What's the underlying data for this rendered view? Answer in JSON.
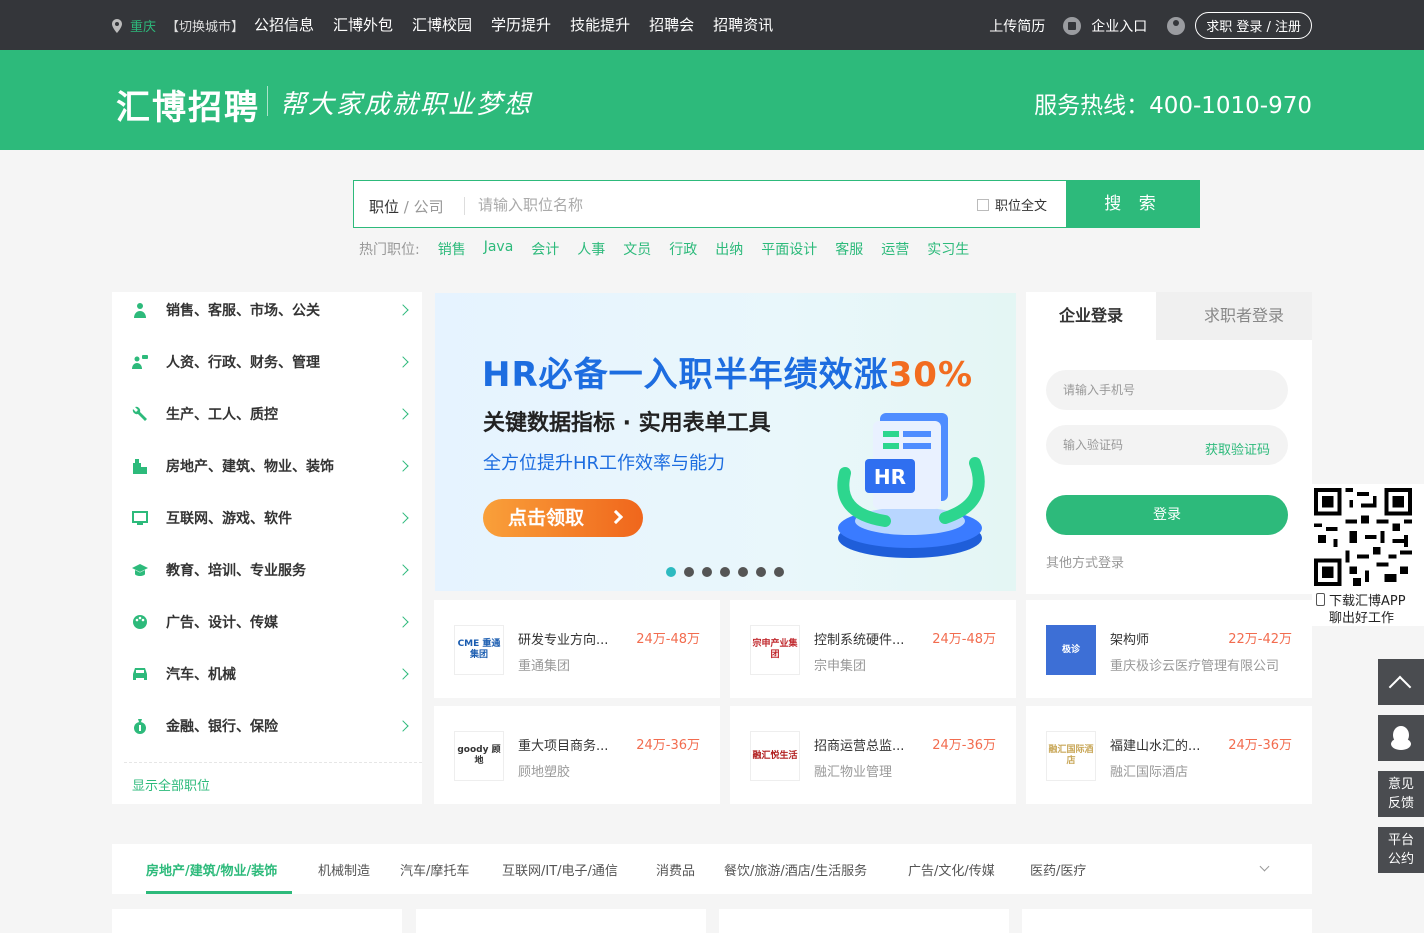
{
  "topbar": {
    "city": "重庆",
    "switch_city": "【切换城市】",
    "nav": [
      "公招信息",
      "汇博外包",
      "汇博校园",
      "学历提升",
      "技能提升",
      "招聘会",
      "招聘资讯"
    ],
    "upload": "上传简历",
    "enterprise": "企业入口",
    "login": "求职 登录 / 注册"
  },
  "header": {
    "logo": "汇博招聘",
    "slogan": "帮大家成就职业梦想",
    "hotline": "服务热线：400-1010-970"
  },
  "search": {
    "type": "职位",
    "type_sub": " / 公司",
    "placeholder": "请输入职位名称",
    "fulltext": "职位全文",
    "button": "搜 索"
  },
  "hot": {
    "label": "热门职位:",
    "tags": [
      "销售",
      "Java",
      "会计",
      "人事",
      "文员",
      "行政",
      "出纳",
      "平面设计",
      "客服",
      "运营",
      "实习生"
    ]
  },
  "categories": {
    "items": [
      "销售、客服、市场、公关",
      "人资、行政、财务、管理",
      "生产、工人、质控",
      "房地产、建筑、物业、装饰",
      "互联网、游戏、软件",
      "教育、培训、专业服务",
      "广告、设计、传媒",
      "汽车、机械",
      "金融、银行、保险"
    ],
    "icons": [
      "person-icon",
      "people-icon",
      "wrench-icon",
      "building-icon",
      "monitor-icon",
      "graduation-cap-icon",
      "palette-icon",
      "car-icon",
      "money-bag-icon"
    ],
    "more": "显示全部职位"
  },
  "banner": {
    "line1": "HR必备一入职半年绩效涨",
    "line1_pct": "30%",
    "line2": "关键数据指标 · 实用表单工具",
    "line3": "全方位提升HR工作效率与能力",
    "cta": "点击领取",
    "art_label": "HR",
    "slide_count": 7,
    "active_slide": 0
  },
  "login": {
    "tab_enterprise": "企业登录",
    "tab_seeker": "求职者登录",
    "phone_placeholder": "请输入手机号",
    "code_placeholder": "输入验证码",
    "get_code": "获取验证码",
    "submit": "登录",
    "other": "其他方式登录"
  },
  "jobs": [
    {
      "title": "研发专业方向...",
      "salary": "24万-48万",
      "company": "重通集团",
      "logo": "CME 重通集团"
    },
    {
      "title": "控制系统硬件...",
      "salary": "24万-48万",
      "company": "宗申集团",
      "logo": "宗申产业集团"
    },
    {
      "title": "架构师",
      "salary": "22万-42万",
      "company": "重庆极诊云医疗管理有限公司",
      "logo": "极诊"
    },
    {
      "title": "重大项目商务...",
      "salary": "24万-36万",
      "company": "顾地塑胶",
      "logo": "goody 顾地"
    },
    {
      "title": "招商运营总监...",
      "salary": "24万-36万",
      "company": "融汇物业管理",
      "logo": "融汇悦生活"
    },
    {
      "title": "福建山水汇的...",
      "salary": "24万-36万",
      "company": "融汇国际酒店",
      "logo": "融汇国际酒店"
    }
  ],
  "industry": {
    "items": [
      "房地产/建筑/物业/装饰",
      "机械制造",
      "汽车/摩托车",
      "互联网/IT/电子/通信",
      "消费品",
      "餐饮/旅游/酒店/生活服务",
      "广告/文化/传媒",
      "医药/医疗"
    ],
    "active": 0
  },
  "float": {
    "qr_line1": "下载汇博APP",
    "qr_line2": "聊出好工作",
    "feedback": "意见反馈",
    "notice": "平台公约"
  },
  "colors": {
    "brand": "#2dba7b",
    "topbar": "#34363a",
    "salary": "#f26c4f"
  }
}
